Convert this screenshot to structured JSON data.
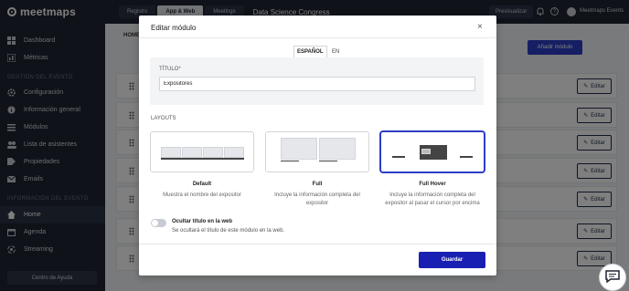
{
  "brand": {
    "name": "meetmaps"
  },
  "sidebar": {
    "main_items": [
      {
        "label": "Dashboard",
        "icon": "dashboard-icon"
      },
      {
        "label": "Métricas",
        "icon": "chart-icon"
      }
    ],
    "section_event_title": "GESTIÓN DEL EVENTO",
    "event_items": [
      {
        "label": "Configuración",
        "icon": "gear-icon"
      },
      {
        "label": "Información general",
        "icon": "info-icon"
      },
      {
        "label": "Módulos",
        "icon": "list-icon"
      },
      {
        "label": "Lista de asistentes",
        "icon": "users-icon"
      },
      {
        "label": "Propiedades",
        "icon": "tag-icon"
      },
      {
        "label": "Emails",
        "icon": "mail-icon"
      }
    ],
    "section_info_title": "INFORMACIÓN DEL EVENTO",
    "info_items": [
      {
        "label": "Home",
        "icon": "home-icon"
      },
      {
        "label": "Agenda",
        "icon": "calendar-icon"
      },
      {
        "label": "Streaming",
        "icon": "broadcast-icon"
      }
    ],
    "help_label": "Centro de Ayuda"
  },
  "topbar": {
    "tabs": [
      "Registro",
      "App & Web",
      "Meetings"
    ],
    "event_name": "Data Science Congress",
    "preview_label": "Previsualizar",
    "user_name": "Meetmaps Events"
  },
  "background": {
    "tab_label": "HOME",
    "add_label": "Añadir módulo",
    "edit_label": "Editar"
  },
  "modal": {
    "title": "Editar módulo",
    "close": "×",
    "lang_tabs": [
      "ESPAÑOL",
      "EN"
    ],
    "title_field_label": "TÍTULO*",
    "title_value": "Expositores",
    "layouts_label": "LAYOUTS",
    "layouts": [
      {
        "name": "Default",
        "description": "Muestra el nombre del expositor"
      },
      {
        "name": "Full",
        "description": "Incluye la información completa del expositor"
      },
      {
        "name": "Full Hover",
        "description": "Incluye la información completa del expositor al pasar el cursor por encima"
      }
    ],
    "toggle_label": "Ocultar título en la web",
    "toggle_desc": "Se ocultará el título de este módulo en la web.",
    "save_label": "Guardar"
  },
  "colors": {
    "sidebar_bg": "#1e2433",
    "accent": "#1a1fb3",
    "selected_border": "#2c3ec7"
  }
}
